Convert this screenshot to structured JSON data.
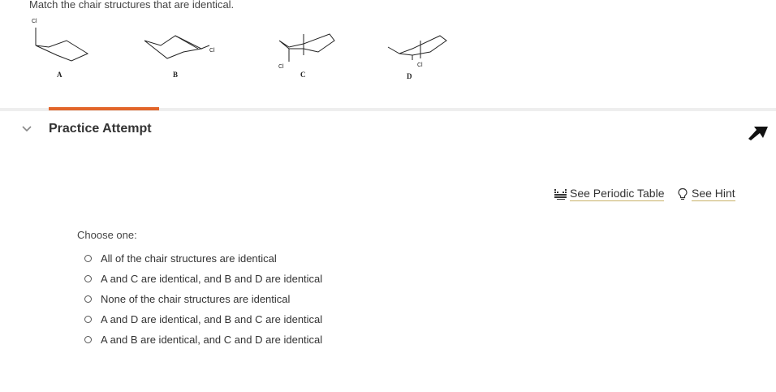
{
  "question": {
    "prompt": "Match the chair structures that are identical.",
    "structure_labels": [
      "A",
      "B",
      "C",
      "D"
    ],
    "substituent": "Cl"
  },
  "section": {
    "title": "Practice Attempt"
  },
  "tools": {
    "periodic_table": "See Periodic Table",
    "hint": "See Hint"
  },
  "answer": {
    "choose_label": "Choose one:",
    "options": [
      "All of the chair structures are identical",
      "A and C are identical, and B and D are identical",
      "None of the chair structures are identical",
      "A and D are identical, and B and C are identical",
      "A and B are identical, and C and D are identical"
    ]
  },
  "colors": {
    "accent": "#e2652a",
    "divider": "#eeeeee",
    "hint_underline": "#c9b26a"
  }
}
